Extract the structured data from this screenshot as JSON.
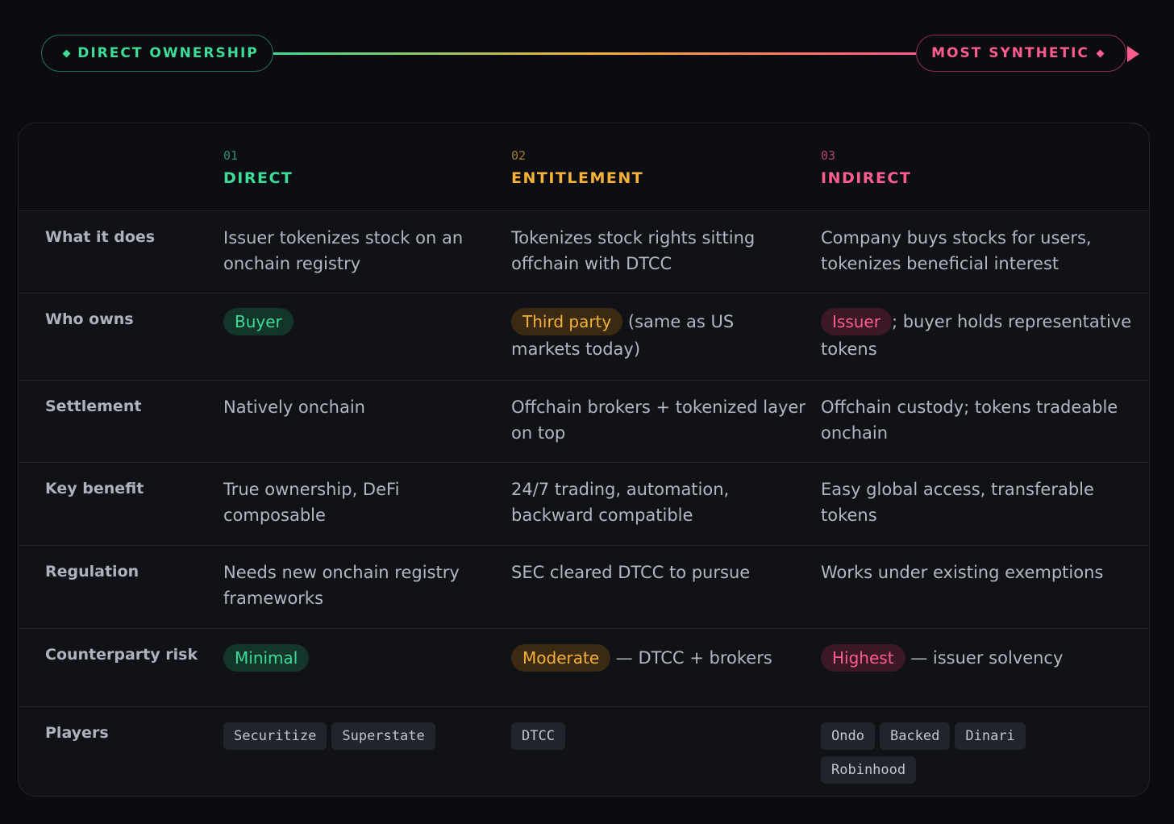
{
  "spectrum": {
    "left_label": "DIRECT OWNERSHIP",
    "right_label": "MOST SYNTHETIC"
  },
  "columns": [
    {
      "num": "01",
      "title": "DIRECT",
      "color": "#3ddc97"
    },
    {
      "num": "02",
      "title": "ENTITLEMENT",
      "color": "#f5b13a"
    },
    {
      "num": "03",
      "title": "INDIRECT",
      "color": "#ff5d8f"
    }
  ],
  "rows": {
    "what": {
      "label": "What it does",
      "c1": "Issuer tokenizes stock on an onchain registry",
      "c2": "Tokenizes stock rights sitting offchain with DTCC",
      "c3": "Company buys stocks for users, tokenizes beneficial interest"
    },
    "owns": {
      "label": "Who owns",
      "c1_tag": "Buyer",
      "c2_tag": "Third party",
      "c2_text": " (same as US markets today)",
      "c3_tag": "Issuer",
      "c3_text": "; buyer holds representative tokens"
    },
    "settlement": {
      "label": "Settlement",
      "c1": "Natively onchain",
      "c2": "Offchain brokers + tokenized layer on top",
      "c3": "Offchain custody; tokens tradeable onchain"
    },
    "benefit": {
      "label": "Key benefit",
      "c1": "True ownership, DeFi composable",
      "c2": "24/7 trading, automation, backward compatible",
      "c3": "Easy global access, transferable tokens"
    },
    "regulation": {
      "label": "Regulation",
      "c1": "Needs new onchain registry frameworks",
      "c2": "SEC cleared DTCC to pursue",
      "c3": "Works under existing exemptions"
    },
    "risk": {
      "label": "Counterparty risk",
      "c1_tag": "Minimal",
      "c2_tag": "Moderate",
      "c2_text": " — DTCC + brokers",
      "c3_tag": "Highest",
      "c3_text": " — issuer solvency"
    },
    "players": {
      "label": "Players",
      "c1": [
        "Securitize",
        "Superstate"
      ],
      "c2": [
        "DTCC"
      ],
      "c3": [
        "Ondo",
        "Backed",
        "Dinari",
        "Robinhood"
      ]
    }
  }
}
